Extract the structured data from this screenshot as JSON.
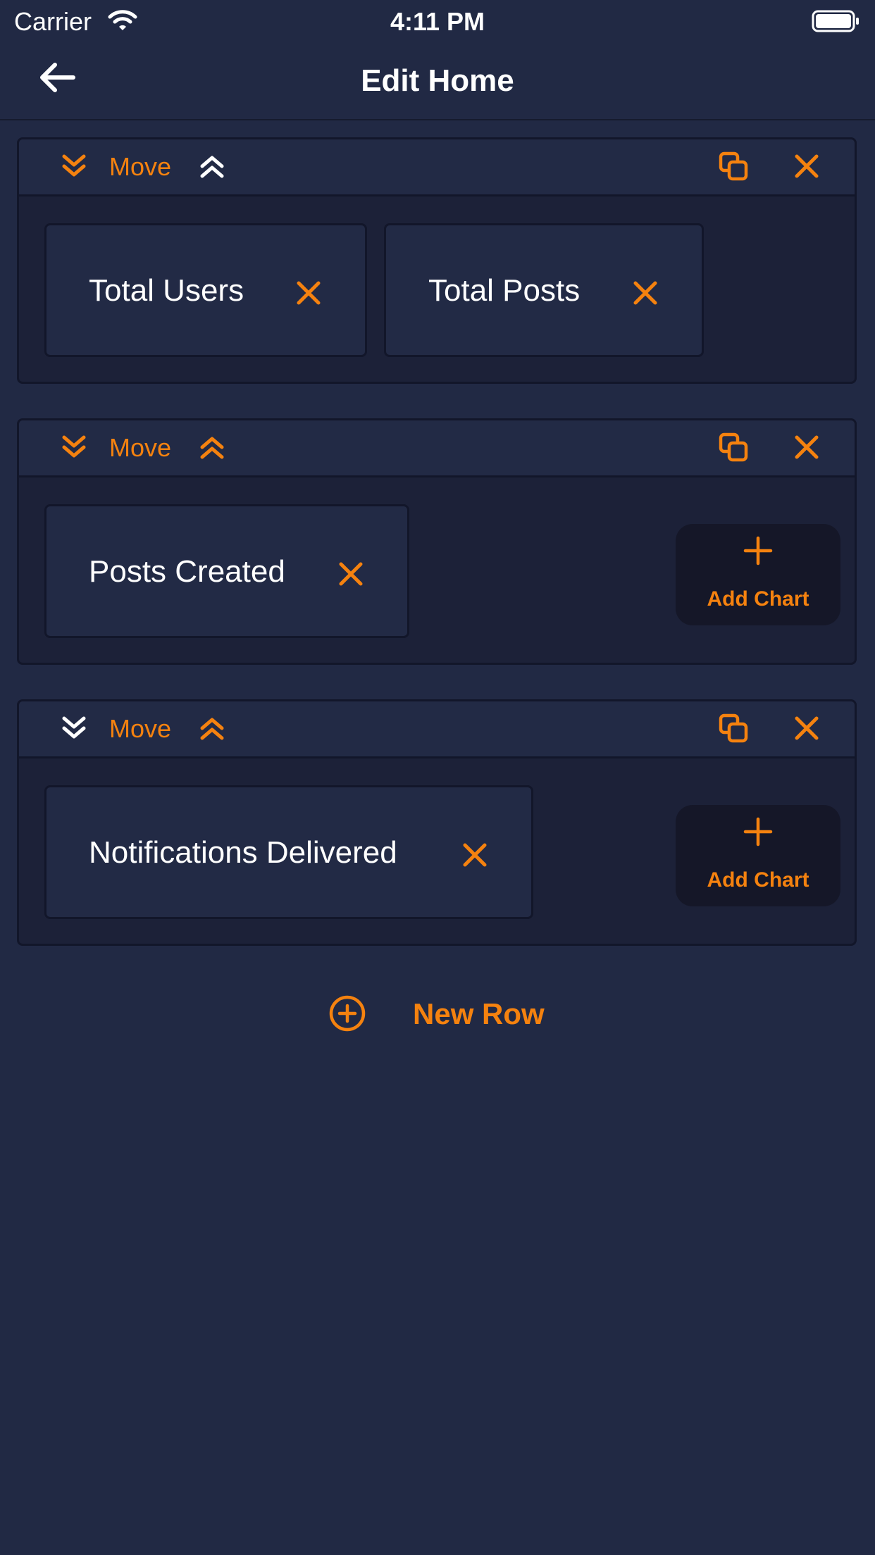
{
  "status_bar": {
    "carrier": "Carrier",
    "time": "4:11 PM"
  },
  "header": {
    "title": "Edit Home"
  },
  "rows": [
    {
      "move_label": "Move",
      "charts": [
        {
          "label": "Total Users"
        },
        {
          "label": "Total Posts"
        }
      ]
    },
    {
      "move_label": "Move",
      "charts": [
        {
          "label": "Posts Created"
        }
      ],
      "add_chart_label": "Add Chart"
    },
    {
      "move_label": "Move",
      "charts": [
        {
          "label": "Notifications Delivered"
        }
      ],
      "add_chart_label": "Add Chart"
    }
  ],
  "new_row_label": "New Row",
  "colors": {
    "accent": "#f5820f",
    "background": "#212944",
    "card": "#222a45",
    "card_inner": "#1c2138"
  }
}
